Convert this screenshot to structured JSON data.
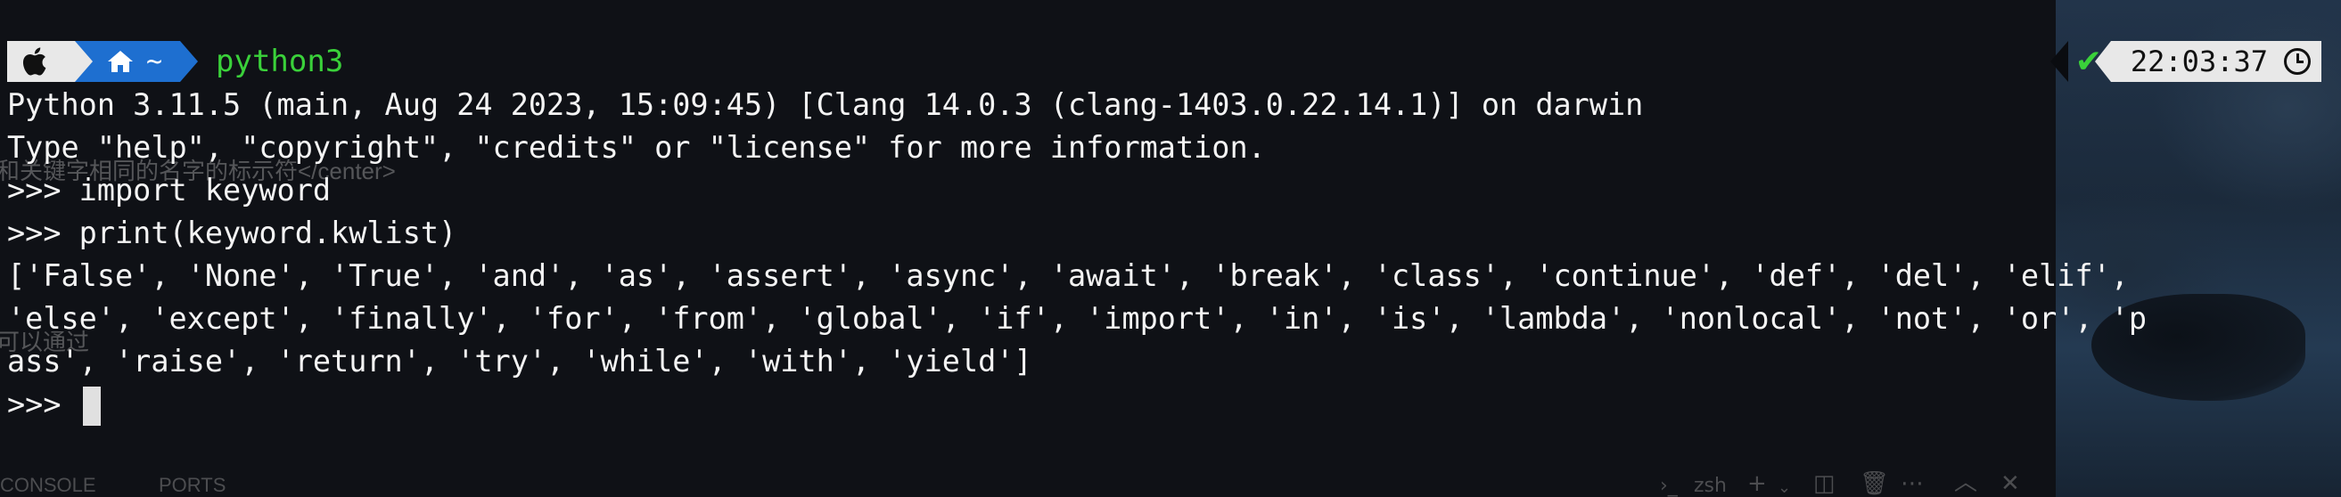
{
  "prompt": {
    "apple_icon": "apple-logo-icon",
    "home_icon": "home-icon",
    "directory": "~",
    "command": "python3"
  },
  "right_prompt": {
    "status_icon": "checkmark-icon",
    "status_mark": "✔",
    "time": "22:03:37",
    "clock_icon": "clock-icon"
  },
  "output": {
    "line1": "Python 3.11.5 (main, Aug 24 2023, 15:09:45) [Clang 14.0.3 (clang-1403.0.22.14.1)] on darwin",
    "line2": "Type \"help\", \"copyright\", \"credits\" or \"license\" for more information.",
    "line3": ">>> import keyword",
    "line4": ">>> print(keyword.kwlist)",
    "line5": "['False', 'None', 'True', 'and', 'as', 'assert', 'async', 'await', 'break', 'class', 'continue', 'def', 'del', 'elif',",
    "line6": "'else', 'except', 'finally', 'for', 'from', 'global', 'if', 'import', 'in', 'is', 'lambda', 'nonlocal', 'not', 'or', 'p",
    "line7": "ass', 'raise', 'return', 'try', 'while', 'with', 'yield']",
    "line8": ">>> "
  },
  "background_ghost": {
    "text1": "和关键字相同的名字的标示符</center>",
    "text2": "可以通过"
  },
  "bottom_panel": {
    "console_tab": "CONSOLE",
    "ports_tab": "PORTS",
    "shell_label": "zsh"
  },
  "colors": {
    "background": "#0f1116",
    "prompt_green": "#3ad13a",
    "home_segment": "#1e6fd0",
    "light_segment": "#e8e8e8"
  }
}
